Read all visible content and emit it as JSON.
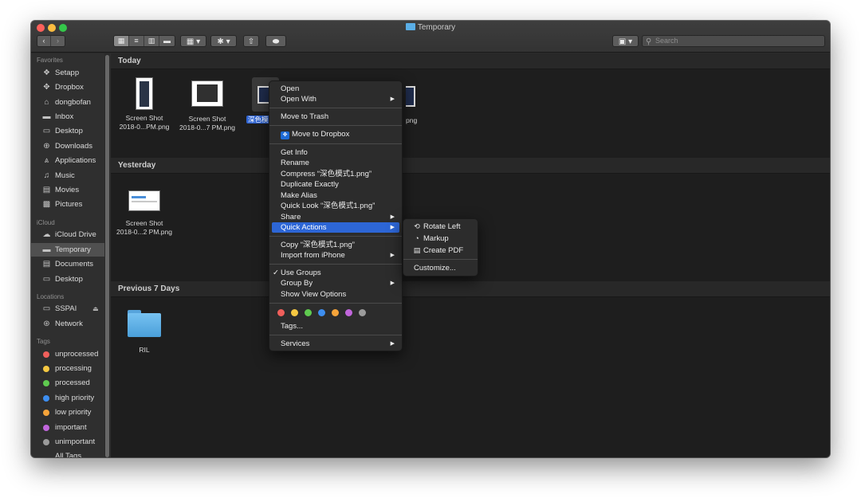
{
  "window": {
    "title": "Temporary"
  },
  "toolbar": {
    "back_icon": "chevron-left-icon",
    "forward_icon": "chevron-right-icon",
    "view_modes": [
      "icon-view-icon",
      "list-view-icon",
      "column-view-icon",
      "gallery-view-icon"
    ],
    "group_icon": "group-icon",
    "action_icon": "gear-icon",
    "share_icon": "share-icon",
    "tag_icon": "tag-icon",
    "dropbox_icon": "dropbox-icon",
    "search_placeholder": "Search"
  },
  "sidebar": {
    "favorites_label": "Favorites",
    "favorites": [
      {
        "label": "Setapp",
        "icon": "setapp-icon"
      },
      {
        "label": "Dropbox",
        "icon": "dropbox-icon"
      },
      {
        "label": "dongbofan",
        "icon": "home-icon"
      },
      {
        "label": "Inbox",
        "icon": "folder-icon"
      },
      {
        "label": "Desktop",
        "icon": "desktop-icon"
      },
      {
        "label": "Downloads",
        "icon": "downloads-icon"
      },
      {
        "label": "Applications",
        "icon": "applications-icon"
      },
      {
        "label": "Music",
        "icon": "music-icon"
      },
      {
        "label": "Movies",
        "icon": "movies-icon"
      },
      {
        "label": "Pictures",
        "icon": "pictures-icon"
      }
    ],
    "icloud_label": "iCloud",
    "icloud": [
      {
        "label": "iCloud Drive",
        "icon": "cloud-icon"
      },
      {
        "label": "Temporary",
        "icon": "folder-icon",
        "selected": true
      },
      {
        "label": "Documents",
        "icon": "documents-icon"
      },
      {
        "label": "Desktop",
        "icon": "desktop-icon"
      }
    ],
    "locations_label": "Locations",
    "locations": [
      {
        "label": "SSPAI",
        "icon": "drive-icon",
        "eject": "⏏"
      },
      {
        "label": "Network",
        "icon": "network-icon"
      }
    ],
    "tags_label": "Tags",
    "tags": [
      {
        "label": "unprocessed",
        "color": "#f05f5b"
      },
      {
        "label": "processing",
        "color": "#f6c842"
      },
      {
        "label": "processed",
        "color": "#5fcb4f"
      },
      {
        "label": "high priority",
        "color": "#3d8ef0"
      },
      {
        "label": "low priority",
        "color": "#f6a43a"
      },
      {
        "label": "important",
        "color": "#c166dc"
      },
      {
        "label": "unimportant",
        "color": "#9b9b9b"
      },
      {
        "label": "All Tags..."
      }
    ]
  },
  "sections": {
    "today": "Today",
    "yesterday": "Yesterday",
    "previous": "Previous 7 Days"
  },
  "files": {
    "today": [
      {
        "name_line1": "Screen Shot",
        "name_line2": "2018-0...PM.png"
      },
      {
        "name_line1": "Screen Shot",
        "name_line2": "2018-0...7 PM.png"
      },
      {
        "name_highlight": "深色模"
      },
      {
        "name_tail": "png"
      }
    ],
    "yesterday": [
      {
        "name_line1": "Screen Shot",
        "name_line2": "2018-0...2 PM.png"
      }
    ],
    "previous": [
      {
        "name": "RIL"
      }
    ]
  },
  "context_menu": {
    "open": "Open",
    "open_with": "Open With",
    "move_to_trash": "Move to Trash",
    "move_to_dropbox": "Move to Dropbox",
    "get_info": "Get Info",
    "rename": "Rename",
    "compress": "Compress “深色模式1.png”",
    "duplicate_exactly": "Duplicate Exactly",
    "make_alias": "Make Alias",
    "quick_look": "Quick Look “深色模式1.png”",
    "share": "Share",
    "quick_actions": "Quick Actions",
    "copy": "Copy “深色模式1.png”",
    "import_from_iphone": "Import from iPhone",
    "check_mark": "✓",
    "use_groups": "Use Groups",
    "group_by": "Group By",
    "show_view_options": "Show View Options",
    "tag_colors": [
      "#f05f5b",
      "#f6c842",
      "#5fcb4f",
      "#3d8ef0",
      "#f6a43a",
      "#c166dc",
      "#9b9b9b"
    ],
    "tags": "Tags...",
    "services": "Services",
    "submenu_arrow": "▶"
  },
  "quick_actions_menu": {
    "rotate_left": "Rotate Left",
    "markup": "Markup",
    "create_pdf": "Create PDF",
    "customize": "Customize..."
  }
}
